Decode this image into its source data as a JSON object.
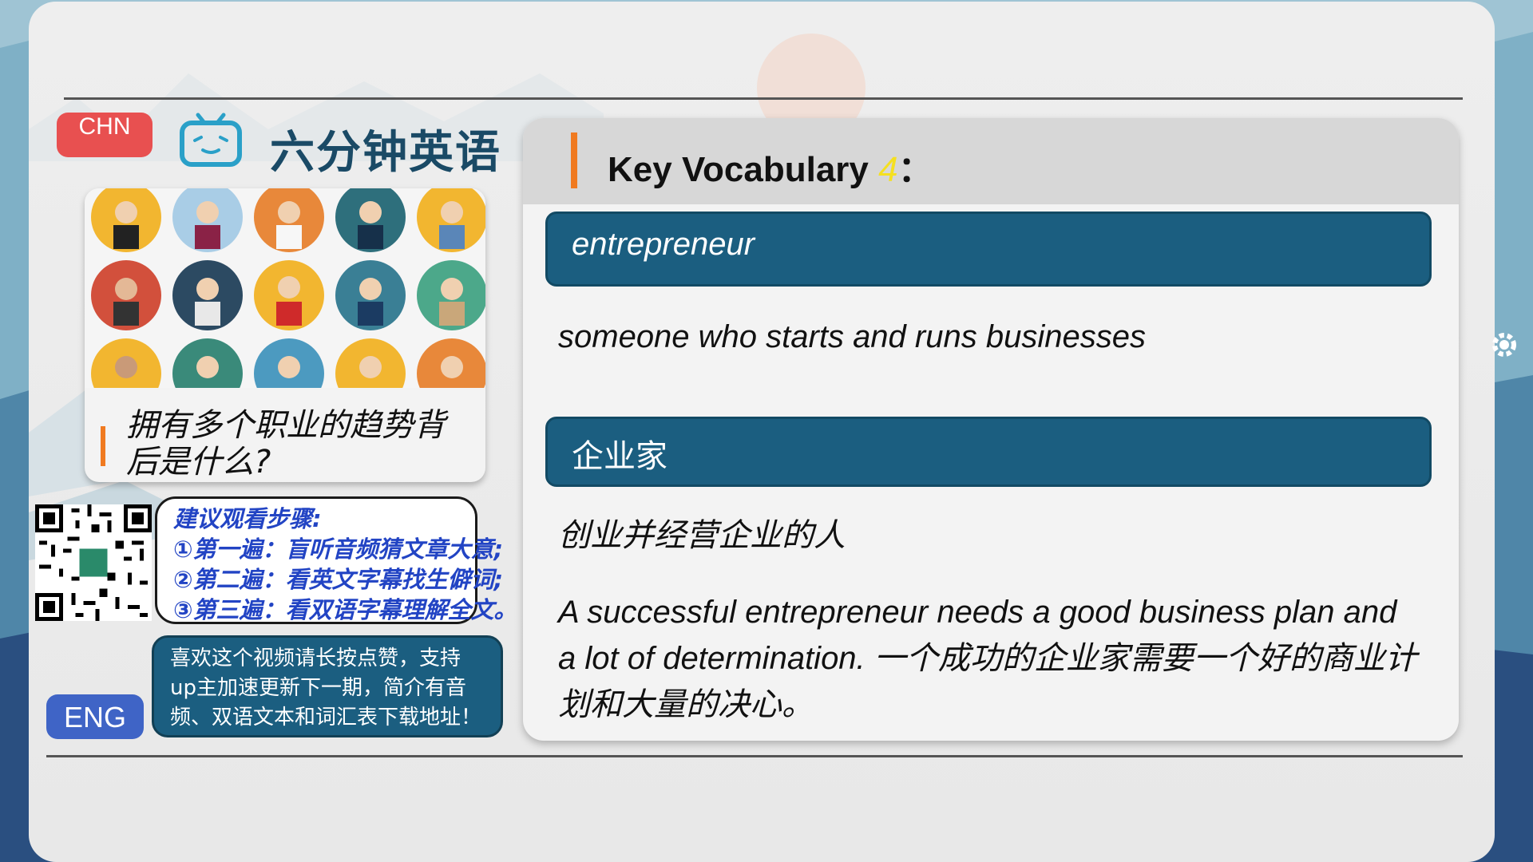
{
  "language_buttons": {
    "chinese": "CHN",
    "english": "ENG"
  },
  "brand": {
    "title": "六分钟英语",
    "icon": "tv-icon"
  },
  "left_card": {
    "title": "拥有多个职业的趋势背后是什么?",
    "image": "career-avatars"
  },
  "qr_code": {
    "icon": "qr-code"
  },
  "steps": {
    "lines": [
      "建议观看步骤:",
      "①第一遍：盲听音频猜文章大意;",
      "②第二遍：看英文字幕找生僻词;",
      "③第三遍：看双语字幕理解全文。"
    ]
  },
  "like_box": {
    "lines": [
      "喜欢这个视频请长按点赞，支持",
      "up主加速更新下一期，简介有音",
      "频、双语文本和词汇表下载地址！"
    ]
  },
  "vocab": {
    "heading": "Key Vocabulary",
    "number": "4",
    "colon": "：",
    "term": "entrepreneur",
    "definition_en": "someone who starts and runs businesses",
    "term_cn": "企业家",
    "definition_cn": "创业并经营企业的人",
    "example": "A successful entrepreneur needs a good business plan and a lot of determination. 一个成功的企业家需要一个好的商业计划和大量的决心。"
  },
  "colors": {
    "accent_orange": "#f07a20",
    "band_blue": "#1b5e80",
    "chn_red": "#e85050",
    "eng_blue": "#3f64c6"
  }
}
